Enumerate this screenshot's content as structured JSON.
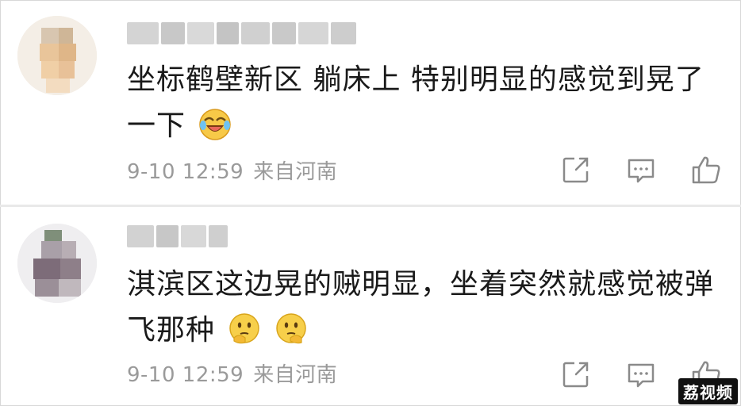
{
  "comments": [
    {
      "text_line1": "坐标鹤壁新区 躺床上 特别明显的感觉到晃了",
      "text_line2": "一下",
      "emoji": "laughing-crying-emoji",
      "date": "9-10 12:59",
      "location": "来自河南"
    },
    {
      "text_line1": "淇滨区这边晃的贼明显，坐着突然就感觉被弹",
      "text_line2": "飞那种",
      "emoji": "thinking-face-emoji",
      "date": "9-10 12:59",
      "location": "来自河南"
    }
  ],
  "icons": {
    "share": "share-icon",
    "comment": "comment-icon",
    "like": "thumbs-up-icon"
  },
  "colors": {
    "text": "#1a1a1a",
    "meta": "#9a9a9a",
    "icon": "#8a8a8a",
    "divider": "#e9e9e9"
  },
  "watermark": "荔视频"
}
